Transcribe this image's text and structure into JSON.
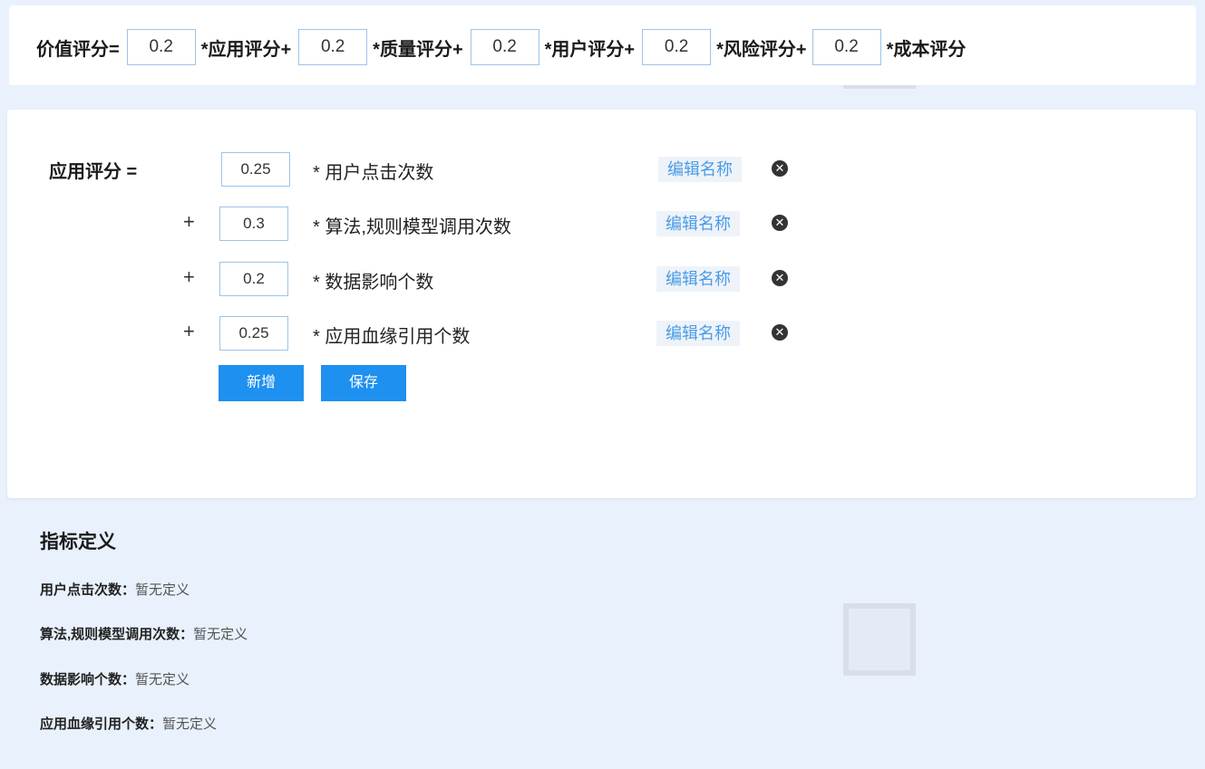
{
  "formula": {
    "result_label": "价值评分=",
    "terms": [
      {
        "weight": "0.2",
        "label": "*应用评分+"
      },
      {
        "weight": "0.2",
        "label": "*质量评分+"
      },
      {
        "weight": "0.2",
        "label": "*用户评分+"
      },
      {
        "weight": "0.2",
        "label": "*风险评分+"
      },
      {
        "weight": "0.2",
        "label": "*成本评分"
      }
    ]
  },
  "rule": {
    "lhs": "应用评分 =",
    "plus": "+",
    "edit_label": "编辑名称",
    "delete_icon": "close-circle-icon",
    "items": [
      {
        "weight": "0.25",
        "name": "* 用户点击次数"
      },
      {
        "weight": "0.3",
        "name": "* 算法,规则模型调用次数"
      },
      {
        "weight": "0.2",
        "name": "* 数据影响个数"
      },
      {
        "weight": "0.25",
        "name": "* 应用血缘引用个数"
      }
    ],
    "add_label": "新增",
    "save_label": "保存"
  },
  "definitions": {
    "title": "指标定义",
    "items": [
      {
        "term": "用户点击次数：",
        "value": "暂无定义"
      },
      {
        "term": "算法,规则模型调用次数：",
        "value": "暂无定义"
      },
      {
        "term": "数据影响个数：",
        "value": "暂无定义"
      },
      {
        "term": "应用血缘引用个数：",
        "value": "暂无定义"
      }
    ]
  },
  "colors": {
    "page_bg": "#e9f1fc",
    "accent": "#1e90f0",
    "link": "#4a9be8",
    "input_border": "#9cc4ea"
  }
}
